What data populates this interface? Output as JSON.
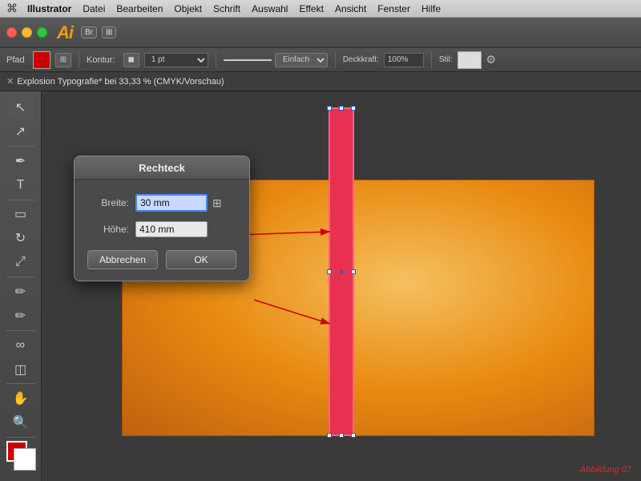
{
  "menubar": {
    "apple": "⌘",
    "app_name": "Illustrator",
    "menus": [
      "Datei",
      "Bearbeiten",
      "Objekt",
      "Schrift",
      "Auswahl",
      "Effekt",
      "Ansicht",
      "Fenster",
      "Hilfe"
    ]
  },
  "titlebar": {
    "ai_logo": "Ai",
    "bridge_label": "Br",
    "arr_label": "▾▸"
  },
  "optionsbar": {
    "path_label": "Pfad",
    "kontur_label": "Kontur:",
    "stroke_style": "Einfach",
    "deckkraft_label": "Deckkraft:",
    "deckkraft_value": "100%",
    "stil_label": "Stil:",
    "settings_icon": "⚙"
  },
  "tabbar": {
    "close_icon": "✕",
    "tab_title": "Explosion Typografie* bei 33,33 % (CMYK/Vorschau)"
  },
  "toolbar": {
    "tools": [
      "↖",
      "↔",
      "✂",
      "✒",
      "T",
      "▭",
      "⬜",
      "⬡",
      "✏",
      "✋",
      "🔍",
      "📊"
    ],
    "fg_color": "#cc0000",
    "bg_color": "#ffffff"
  },
  "dialog": {
    "title": "Rechteck",
    "breite_label": "Breite:",
    "breite_value": "30 mm",
    "hoehe_label": "Höhe:",
    "hoehe_value": "410 mm",
    "cancel_label": "Abbrechen",
    "ok_label": "OK"
  },
  "canvas": {
    "red_stripe_width": "30 mm",
    "red_stripe_height": "410 mm"
  },
  "caption": "Abbildung  07"
}
